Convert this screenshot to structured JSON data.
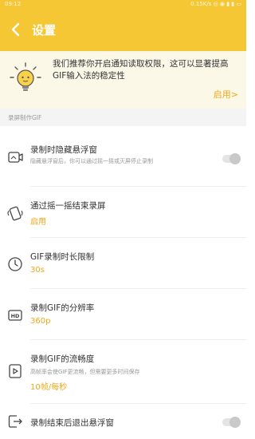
{
  "status_bar": {
    "time": "09:12",
    "right": "0.15K/s ◎ ◉ ▮ ▮ ▭"
  },
  "header": {
    "title": "设置",
    "back_icon": "chevron-left-icon"
  },
  "banner": {
    "text": "我们推荐你开启通知读取权限，这可以显著提高GIF输入法的稳定性",
    "action": "启用>"
  },
  "section": {
    "title": "录屏制作GIF"
  },
  "items": [
    {
      "title": "录制时隐藏悬浮窗",
      "subtitle": "隐藏悬浮窗后，你可以通过摇一摇或灭屏停止录制",
      "toggle_on": false,
      "icon": "screen-record-icon"
    },
    {
      "title": "通过摇一摇结束录屏",
      "value": "启用",
      "icon": "shake-icon"
    },
    {
      "title": "GIF录制时长限制",
      "value": "30s",
      "icon": "clock-icon"
    },
    {
      "title": "录制GIF的分辨率",
      "value": "360p",
      "icon": "hd-icon"
    },
    {
      "title": "录制GIF的流畅度",
      "subtitle": "高帧率会使GIF更流畅，但需要更多时间保存",
      "value": "10帧/每秒",
      "icon": "video-icon"
    },
    {
      "title": "录制结束后退出悬浮窗",
      "toggle_on": false,
      "icon": "exit-icon"
    }
  ],
  "colors": {
    "accent": "#f6c734",
    "value": "#f0a818"
  }
}
